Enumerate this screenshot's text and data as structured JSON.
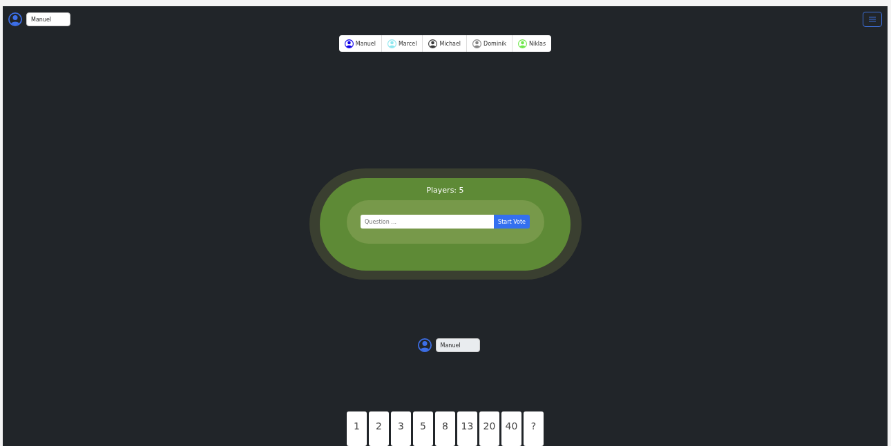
{
  "header": {
    "name_value": "Manuel"
  },
  "players": [
    {
      "name": "Manuel",
      "color": "#0d00e8"
    },
    {
      "name": "Marcel",
      "color": "#8ee8f0"
    },
    {
      "name": "Michael",
      "color": "#3a3a3a"
    },
    {
      "name": "Dominik",
      "color": "#858585"
    },
    {
      "name": "Niklas",
      "color": "#6ee84a"
    }
  ],
  "table": {
    "title": "Players: 5",
    "question_placeholder": "Question ...",
    "start_button": "Start Vote"
  },
  "me": {
    "name_value": "Manuel",
    "disabled": true
  },
  "cards": [
    "1",
    "2",
    "3",
    "5",
    "8",
    "13",
    "20",
    "40",
    "?"
  ]
}
